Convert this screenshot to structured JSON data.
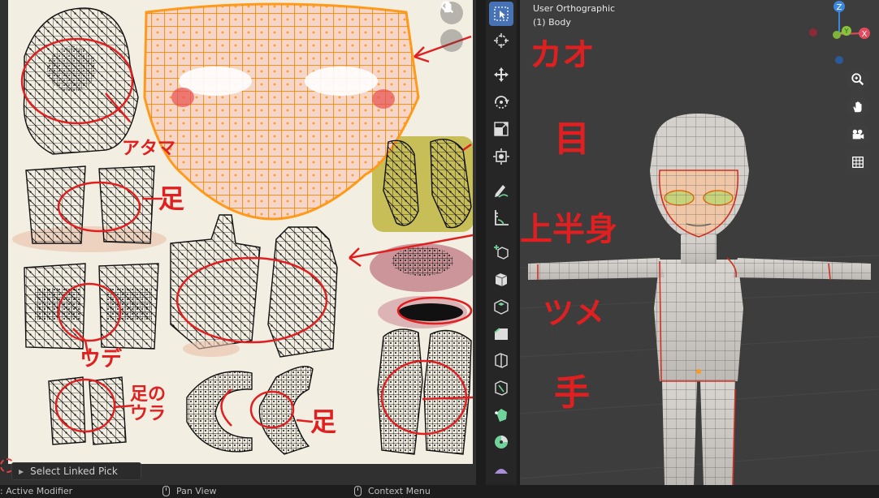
{
  "viewport": {
    "view_name": "User Orthographic",
    "object_name": "(1) Body"
  },
  "gizmo": {
    "z": "Z",
    "y": "Y",
    "x": "X"
  },
  "last_operator": {
    "label": "Select Linked Pick"
  },
  "statusbar": {
    "item1": ": Active Modifier",
    "item2": "Pan View",
    "item3": "Context Menu"
  },
  "annotations": {
    "face": "カオ",
    "eyes": "目",
    "upper_body": "上半身",
    "head": "アタマ",
    "legs": "足",
    "arms": "ウデ",
    "nails": "ツメ",
    "hands": "手",
    "soles": "足のウラ",
    "feet": "足"
  },
  "colors": {
    "selection_orange": "#ff9a1a",
    "annotation_red": "#e02020",
    "active_tool_blue": "#4772b3",
    "x_axis": "#e24a5d",
    "y_axis": "#8ac33a",
    "z_axis": "#3a86e0"
  },
  "toolbar": {
    "tools": [
      "select-box-icon",
      "cursor-icon",
      "move-icon",
      "rotate-icon",
      "scale-icon",
      "transform-icon",
      "annotate-icon",
      "measure-icon",
      "add-cube-icon",
      "extrude-icon",
      "inset-icon",
      "bevel-icon",
      "loop-cut-icon",
      "knife-icon",
      "poly-build-icon",
      "spin-icon",
      "smooth-icon"
    ]
  }
}
